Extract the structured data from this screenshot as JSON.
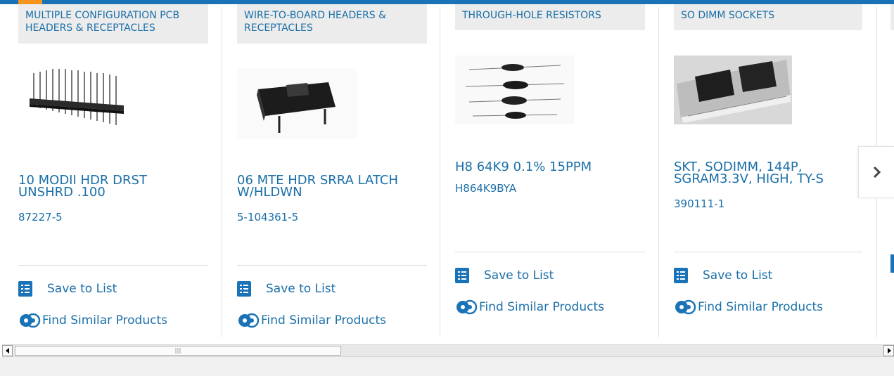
{
  "colors": {
    "accent": "#1a6fa8",
    "brand_bar": "#1a73b7",
    "highlight": "#f7941d"
  },
  "products": [
    {
      "category": "MULTIPLE CONFIGURATION PCB HEADERS & RECEPTACLES",
      "title": "10 MODII HDR DRST UNSHRD .100",
      "part_number": "87227-5",
      "save_label": "Save to List",
      "similar_label": "Find Similar Products",
      "image": "pin-header-photo"
    },
    {
      "category": "WIRE-TO-BOARD HEADERS & RECEPTACLES",
      "title": "06 MTE HDR SRRA LATCH W/HLDWN",
      "part_number": "5-104361-5",
      "save_label": "Save to List",
      "similar_label": "Find Similar Products",
      "image": "board-header-photo"
    },
    {
      "category": "THROUGH-HOLE RESISTORS",
      "title": "H8 64K9 0.1% 15PPM",
      "part_number": "H864K9BYA",
      "save_label": "Save to List",
      "similar_label": "Find Similar Products",
      "image": "resistor-photo"
    },
    {
      "category": "SO DIMM SOCKETS",
      "title": "SKT, SODIMM, 144P, SGRAM3.3V, HIGH, TY-S",
      "part_number": "390111-1",
      "save_label": "Save to List",
      "similar_label": "Find Similar Products",
      "image": "sodimm-socket-photo"
    }
  ],
  "carousel": {
    "next_icon": "chevron-right-icon"
  },
  "scrollbar": {
    "left_icon": "arrow-left-icon",
    "right_icon": "arrow-right-icon"
  }
}
